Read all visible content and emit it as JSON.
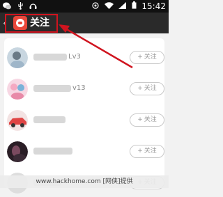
{
  "status_bar": {
    "time": "15:42",
    "left_icons": [
      "wechat-icon",
      "usb-icon",
      "headset-icon"
    ],
    "right_icons": [
      "notify-icon",
      "wifi-icon",
      "signal-icon",
      "battery-icon"
    ]
  },
  "header": {
    "back": "‹",
    "title": "关注"
  },
  "follow_list": [
    {
      "name_suffix": "Lv3",
      "follow_label": "关注",
      "avatar_colors": [
        "#9fb6c9",
        "#6a7a86"
      ]
    },
    {
      "name_suffix": "v13",
      "follow_label": "关注",
      "avatar_colors": [
        "#f5a9c2",
        "#7ab3d9"
      ]
    },
    {
      "name_suffix": "",
      "follow_label": "关注",
      "avatar_colors": [
        "#e04545",
        "#f0d0d0"
      ]
    },
    {
      "name_suffix": "",
      "follow_label": "关注",
      "avatar_colors": [
        "#3a2a35",
        "#7a4a5f"
      ]
    },
    {
      "name_suffix": "",
      "follow_label": "关注",
      "avatar_colors": [
        "#cccccc",
        "#eeeeee"
      ]
    }
  ],
  "watermark": "www.hackhome.com [网侠]提供",
  "colors": {
    "highlight": "#d0141f",
    "arrow": "#d0141f",
    "header_bg": "#2a2a2a"
  }
}
